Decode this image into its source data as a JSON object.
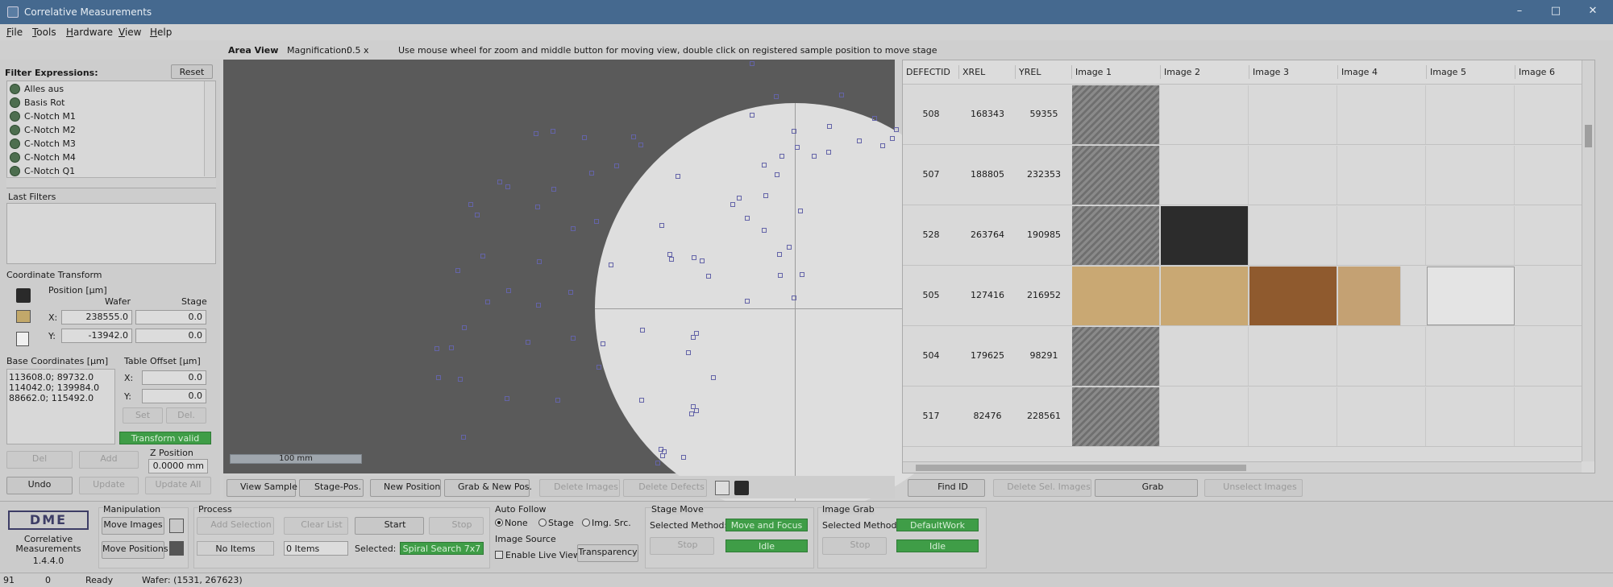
{
  "window": {
    "title": "Correlative Measurements"
  },
  "menu": [
    "File",
    "Tools",
    "Hardware",
    "View",
    "Help"
  ],
  "area_view": {
    "label": "Area View",
    "magnification_label": "Magnification:",
    "magnification_value": "0.5 x",
    "hint": "Use mouse wheel for zoom and middle button for moving view, double click on registered sample position to move stage",
    "scale_bar": "100 mm"
  },
  "filter": {
    "title": "Filter Expressions:",
    "reset_label": "Reset",
    "items": [
      "Alles aus",
      "Basis Rot",
      "C-Notch M1",
      "C-Notch M2",
      "C-Notch M3",
      "C-Notch M4",
      "C-Notch Q1"
    ],
    "last_filters_label": "Last Filters"
  },
  "coordinate_transform": {
    "title": "Coordinate Transform",
    "position_label": "Position [µm]",
    "wafer_col": "Wafer",
    "stage_col": "Stage",
    "x_label": "X:",
    "y_label": "Y:",
    "x_wafer": "238555.0",
    "x_stage": "0.0",
    "y_wafer": "-13942.0",
    "y_stage": "0.0",
    "base_coords_label": "Base Coordinates [µm]",
    "base_coords": [
      "113608.0; 89732.0",
      "114042.0; 139984.0",
      "88662.0; 115492.0"
    ],
    "table_offset_label": "Table Offset [µm]",
    "offset_x": "0.0",
    "offset_y": "0.0",
    "set_label": "Set",
    "del_label": "Del.",
    "transform_status": "Transform valid",
    "del2_label": "Del",
    "add_label": "Add",
    "z_position_label": "Z Position",
    "z_value": "0.0000 mm",
    "undo_label": "Undo",
    "update_label": "Update",
    "update_all_label": "Update All"
  },
  "map_toolbar": {
    "view_sample": "View Sample",
    "stage_pos": "Stage-Pos.",
    "new_position": "New Position",
    "grab_new_pos": "Grab & New Pos.",
    "delete_images": "Delete Images",
    "delete_defects": "Delete Defects"
  },
  "grid": {
    "columns": [
      "DEFECTID",
      "XREL",
      "YREL",
      "Image 1",
      "Image 2",
      "Image 3",
      "Image 4",
      "Image 5",
      "Image 6"
    ],
    "rows": [
      {
        "id": "508",
        "xrel": "168343",
        "yrel": "59355"
      },
      {
        "id": "507",
        "xrel": "188805",
        "yrel": "232353"
      },
      {
        "id": "528",
        "xrel": "263764",
        "yrel": "190985"
      },
      {
        "id": "505",
        "xrel": "127416",
        "yrel": "216952"
      },
      {
        "id": "504",
        "xrel": "179625",
        "yrel": "98291"
      },
      {
        "id": "517",
        "xrel": "82476",
        "yrel": "228561"
      }
    ],
    "find_id": "Find ID",
    "delete_sel_images": "Delete Sel. Images",
    "grab": "Grab",
    "unselect_images": "Unselect Images"
  },
  "bottom": {
    "logo_text": "DME",
    "app_name": "Correlative Measurements",
    "version": "1.4.4.0",
    "manipulation_label": "Manipulation",
    "move_images": "Move Images",
    "move_positions": "Move Positions",
    "process_label": "Process",
    "add_selection": "Add Selection",
    "clear_list": "Clear List",
    "start": "Start",
    "stop": "Stop",
    "no_items": "No Items",
    "zero_items": "0 Items",
    "selected_label": "Selected:",
    "selected_value": "Spiral Search 7x7",
    "auto_follow_label": "Auto Follow",
    "af_none": "None",
    "af_stage": "Stage",
    "af_img": "Img. Src.",
    "image_source_label": "Image Source",
    "enable_live_view": "Enable Live View",
    "transparency": "Transparency",
    "stage_move_label": "Stage Move",
    "selected_method_label": "Selected Method:",
    "stage_method": "Move and Focus",
    "stage_stop": "Stop",
    "stage_status": "Idle",
    "image_grab_label": "Image Grab",
    "grab_method": "DefaultWork",
    "grab_stop": "Stop",
    "grab_status": "Idle"
  },
  "status": {
    "a": "91",
    "b": "0",
    "state": "Ready",
    "wafer": "Wafer: (1531, 267623)"
  },
  "colors": {
    "titlebar": "#45698f",
    "status_green": "#3f9d47",
    "map_bg": "#5a5a5a",
    "wafer": "#dedede"
  }
}
